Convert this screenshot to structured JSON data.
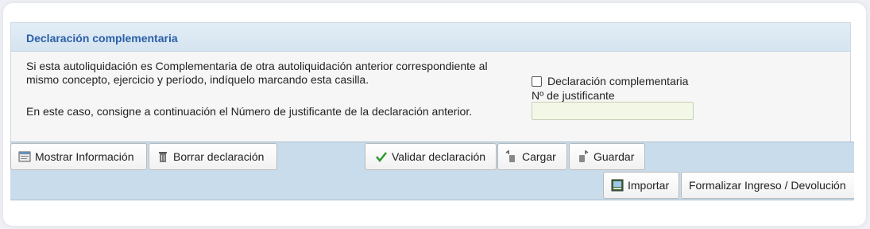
{
  "section": {
    "title": "Declaración complementaria",
    "desc_line1": "Si esta autoliquidación es Complementaria de otra autoliquidación anterior correspondiente al",
    "desc_line2": "mismo concepto, ejercicio y período, indíquelo marcando esta casilla.",
    "desc_line3": "En este caso, consigne a continuación el Número de justificante de la declaración anterior.",
    "checkbox_label": "Declaración complementaria",
    "checkbox_checked": false,
    "justificante_label": "Nº de justificante",
    "justificante_value": ""
  },
  "toolbar": {
    "mostrar": "Mostrar Información",
    "borrar": "Borrar declaración",
    "validar": "Validar declaración",
    "cargar": "Cargar",
    "guardar": "Guardar",
    "importar": "Importar",
    "formalizar": "Formalizar Ingreso / Devolución"
  },
  "colors": {
    "header_title": "#2b5fa8",
    "toolbar_bg": "#c9dcec",
    "check_green": "#2e9a2e",
    "input_bg": "#f3f8e6"
  },
  "icons": {
    "mostrar": "info-window-icon",
    "borrar": "trash-icon",
    "validar": "checkmark-icon",
    "cargar": "load-icon",
    "guardar": "save-icon",
    "importar": "import-icon"
  }
}
